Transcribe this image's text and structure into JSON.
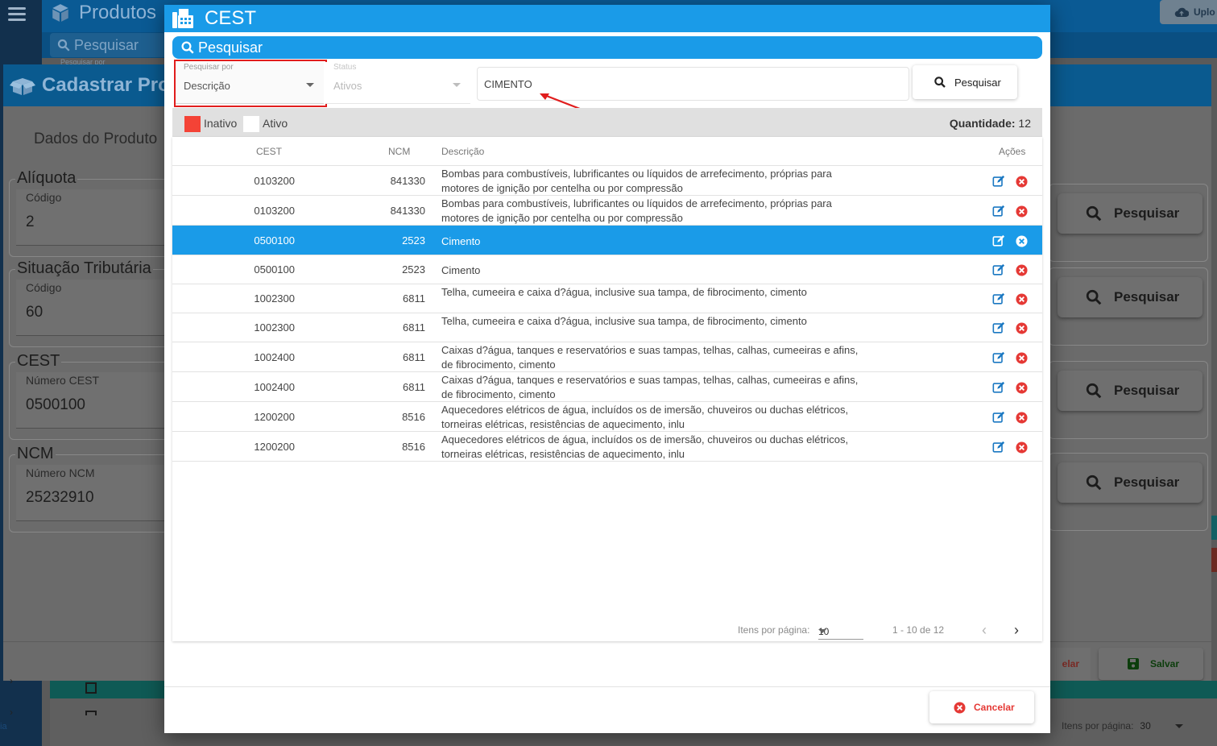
{
  "background": {
    "app_title": "Produtos",
    "upload_label": "Uplo",
    "search_button": "Pesquisar",
    "search_sub": "Pesquisar por",
    "cadastro_title": "Cadastrar Proc",
    "section_title": "Dados do Produto",
    "groups": [
      {
        "legend": "Alíquota",
        "label": "Código",
        "value": "2"
      },
      {
        "legend": "Situação Tributária",
        "label": "Código",
        "value": "60"
      },
      {
        "legend": "CEST",
        "label": "Número CEST",
        "value": "0500100"
      },
      {
        "legend": "NCM",
        "label": "Número NCM",
        "value": "25232910"
      }
    ],
    "right_button": "Pesquisar",
    "cancel_fragment": "elar",
    "save_label": "Salvar",
    "items_per_page_label": "Itens por página:",
    "items_per_page_value": "30",
    "side_label": "ia"
  },
  "modal": {
    "title": "CEST",
    "search_header": "Pesquisar",
    "filters": {
      "pesquisar_por_label": "Pesquisar por",
      "pesquisar_por_value": "Descrição",
      "status_label": "Status",
      "status_value": "Ativos",
      "search_value": "CIMENTO"
    },
    "search_button": "Pesquisar",
    "legend": {
      "inativo_label": "Inativo",
      "ativo_label": "Ativo",
      "inativo_color": "#f44336",
      "ativo_color": "#ffffff",
      "quantidade_label": "Quantidade:",
      "quantidade_value": "12"
    },
    "table": {
      "headers": {
        "cest": "CEST",
        "ncm": "NCM",
        "descricao": "Descrição",
        "acoes": "Ações"
      },
      "rows": [
        {
          "cest": "0103200",
          "ncm": "841330",
          "desc": "Bombas para combustíveis, lubrificantes ou líquidos de arrefecimento, próprias para motores de ignição por centelha ou por compressão",
          "selected": false
        },
        {
          "cest": "0103200",
          "ncm": "841330",
          "desc": "Bombas para combustíveis, lubrificantes ou líquidos de arrefecimento, próprias para motores de ignição por centelha ou por compressão",
          "selected": false
        },
        {
          "cest": "0500100",
          "ncm": "2523",
          "desc": "Cimento",
          "selected": true
        },
        {
          "cest": "0500100",
          "ncm": "2523",
          "desc": "Cimento",
          "selected": false
        },
        {
          "cest": "1002300",
          "ncm": "6811",
          "desc": "Telha, cumeeira e caixa d?água, inclusive sua tampa, de fibrocimento, cimento",
          "selected": false
        },
        {
          "cest": "1002300",
          "ncm": "6811",
          "desc": "Telha, cumeeira e caixa d?água, inclusive sua tampa, de fibrocimento, cimento",
          "selected": false
        },
        {
          "cest": "1002400",
          "ncm": "6811",
          "desc": "Caixas d?água, tanques e reservatórios e suas tampas, telhas, calhas, cumeeiras e afins, de fibrocimento, cimento",
          "selected": false
        },
        {
          "cest": "1002400",
          "ncm": "6811",
          "desc": "Caixas d?água, tanques e reservatórios e suas tampas, telhas, calhas, cumeeiras e afins, de fibrocimento, cimento",
          "selected": false
        },
        {
          "cest": "1200200",
          "ncm": "8516",
          "desc": "Aquecedores elétricos de água, incluídos os de imersão, chuveiros ou duchas elétricos, torneiras elétricas, resistências de aquecimento, inlu",
          "selected": false
        },
        {
          "cest": "1200200",
          "ncm": "8516",
          "desc": "Aquecedores elétricos de água, incluídos os de imersão, chuveiros ou duchas elétricos, torneiras elétricas, resistências de aquecimento, inlu",
          "selected": false
        }
      ]
    },
    "pagination": {
      "items_per_page_label": "Itens por página:",
      "items_per_page_value": "10",
      "range": "1 - 10 de 12"
    },
    "cancel_button": "Cancelar"
  }
}
